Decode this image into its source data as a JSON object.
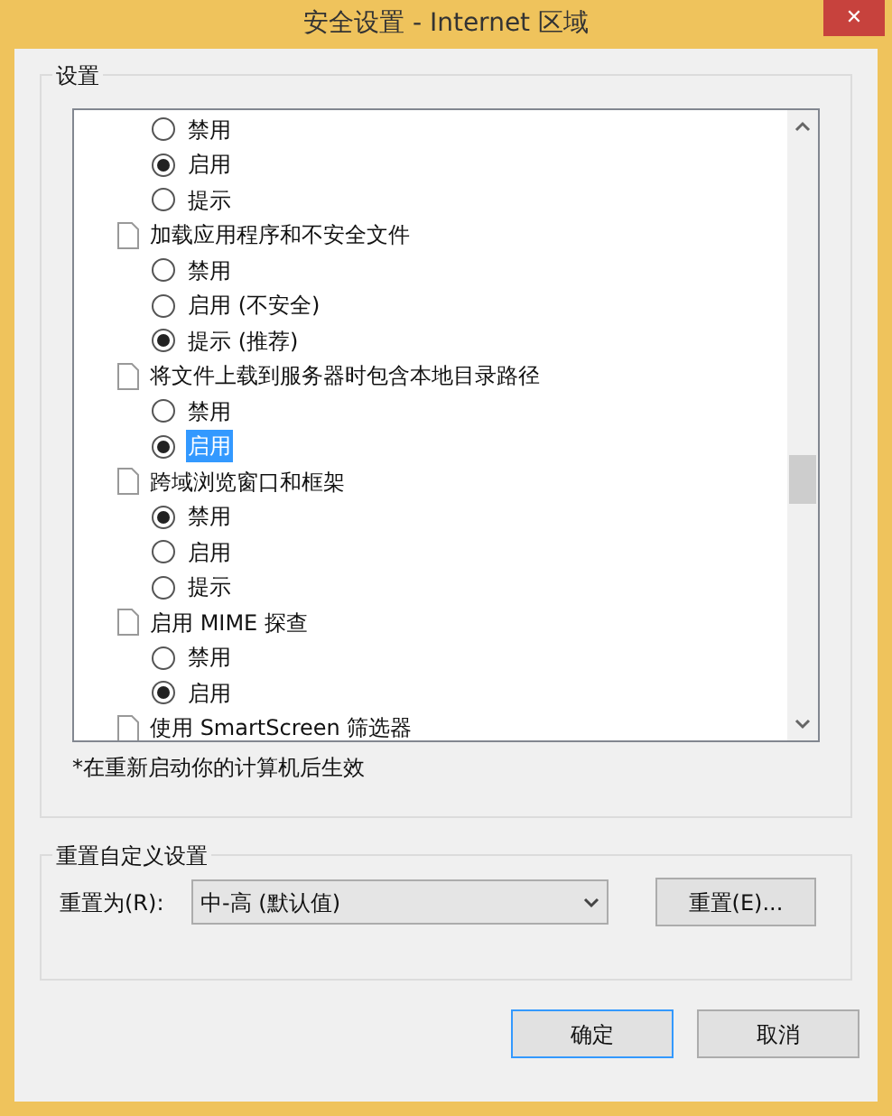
{
  "window": {
    "title": "安全设置 - Internet 区域",
    "close": "✕"
  },
  "settings": {
    "label": "设置",
    "groups": [
      {
        "options": [
          {
            "label": "禁用",
            "selected": false,
            "highlighted": false
          },
          {
            "label": "启用",
            "selected": true,
            "highlighted": false
          },
          {
            "label": "提示",
            "selected": false,
            "highlighted": false
          }
        ]
      },
      {
        "label": "加载应用程序和不安全文件",
        "options": [
          {
            "label": "禁用",
            "selected": false,
            "highlighted": false
          },
          {
            "label": "启用 (不安全)",
            "selected": false,
            "highlighted": false
          },
          {
            "label": "提示 (推荐)",
            "selected": true,
            "highlighted": false
          }
        ]
      },
      {
        "label": "将文件上载到服务器时包含本地目录路径",
        "options": [
          {
            "label": "禁用",
            "selected": false,
            "highlighted": false
          },
          {
            "label": "启用",
            "selected": true,
            "highlighted": true
          }
        ]
      },
      {
        "label": "跨域浏览窗口和框架",
        "options": [
          {
            "label": "禁用",
            "selected": true,
            "highlighted": false
          },
          {
            "label": "启用",
            "selected": false,
            "highlighted": false
          },
          {
            "label": "提示",
            "selected": false,
            "highlighted": false
          }
        ]
      },
      {
        "label": "启用 MIME 探查",
        "options": [
          {
            "label": "禁用",
            "selected": false,
            "highlighted": false
          },
          {
            "label": "启用",
            "selected": true,
            "highlighted": false
          }
        ]
      },
      {
        "label": "使用 SmartScreen 筛选器"
      }
    ],
    "note": "*在重新启动你的计算机后生效"
  },
  "reset": {
    "label": "重置自定义设置",
    "field_label": "重置为(R):",
    "value": "中-高 (默认值)",
    "button": "重置(E)..."
  },
  "buttons": [
    "确定",
    "取消"
  ]
}
